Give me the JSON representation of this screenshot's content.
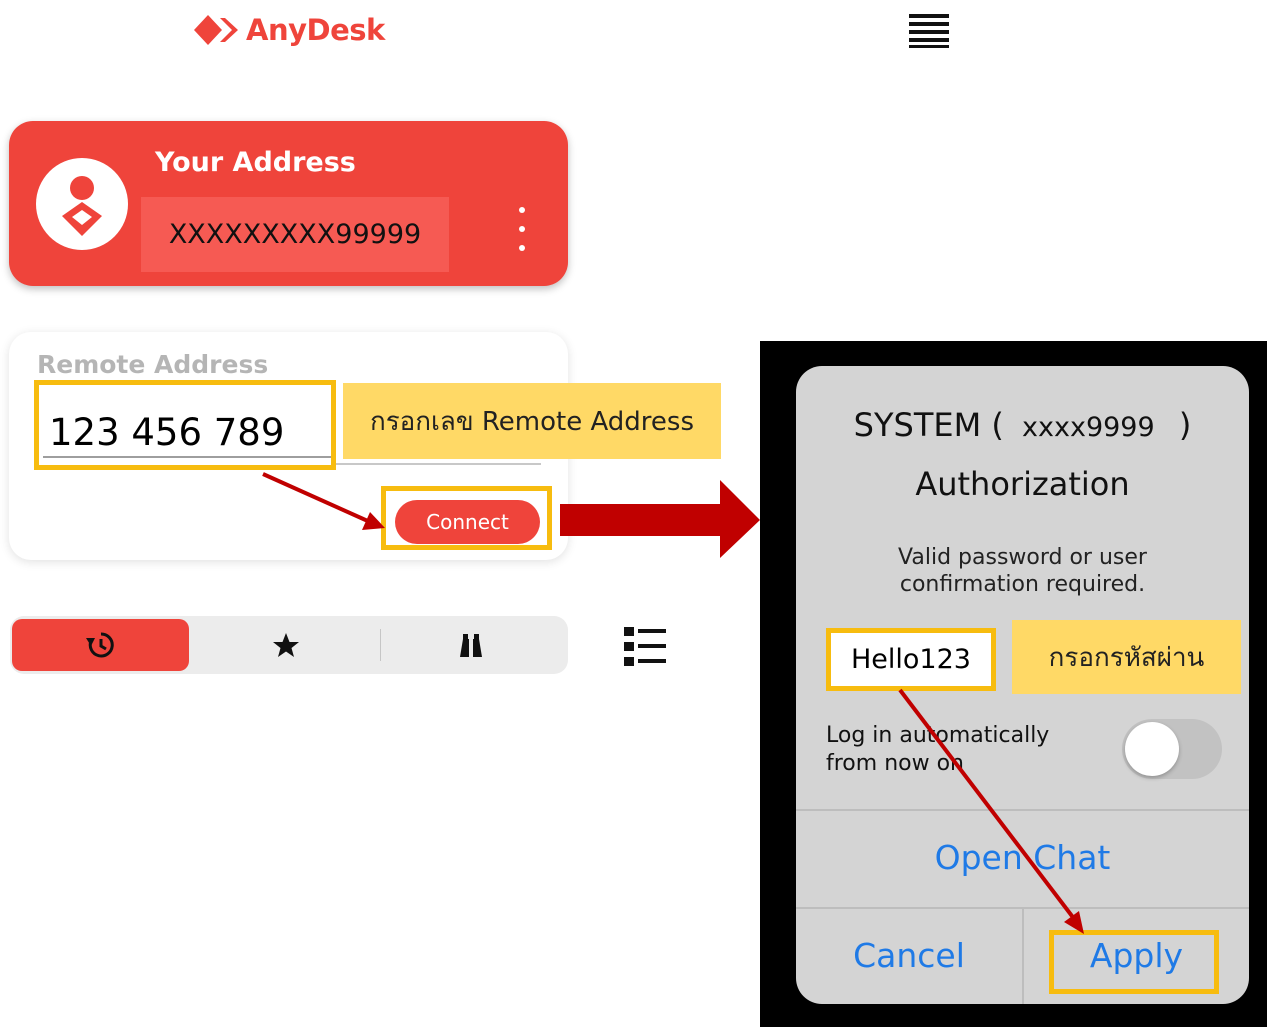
{
  "header": {
    "logo_text": "AnyDesk",
    "menu_icon": "hamburger-menu-icon"
  },
  "address_card": {
    "title": "Your Address",
    "address": "XXXXXXXXX99999",
    "avatar_icon": "anydesk-user-icon",
    "more_icon": "kebab-menu-icon",
    "brand_color": "#ef443b"
  },
  "remote_card": {
    "label": "Remote Address",
    "input_value": "123 456 789",
    "connect_label": "Connect",
    "hint": "กรอกเลข Remote Address"
  },
  "tabs": {
    "items": [
      {
        "icon": "history-icon",
        "active": true
      },
      {
        "icon": "star-icon",
        "active": false
      },
      {
        "icon": "binoculars-icon",
        "active": false
      }
    ],
    "view_icon": "list-view-icon"
  },
  "dialog": {
    "title_line1_prefix": "SYSTEM (",
    "title_line1_id": "xxxx9999",
    "title_line1_suffix": ")",
    "title_line2": "Authorization",
    "message_line1": "Valid password or user",
    "message_line2": "confirmation required.",
    "password_value": "Hello123",
    "password_hint": "กรอกรหัสผ่าน",
    "auto_login_line1": "Log in automatically",
    "auto_login_line2": "from now on",
    "auto_login_enabled": false,
    "open_chat_label": "Open Chat",
    "cancel_label": "Cancel",
    "apply_label": "Apply",
    "link_color": "#1f7ae6"
  },
  "annotations": {
    "highlight_color": "#f7bc0f",
    "arrow_color": "#c00000",
    "note_color": "#ffd966"
  }
}
